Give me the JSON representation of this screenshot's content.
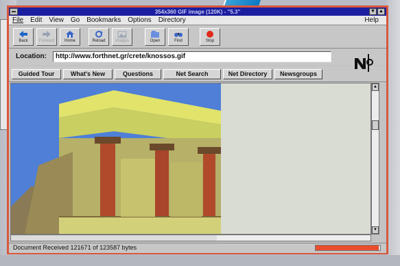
{
  "window": {
    "title": "354x360 GIF image (120K) - \"5.3\""
  },
  "menu": {
    "items": [
      "File",
      "Edit",
      "View",
      "Go",
      "Bookmarks",
      "Options",
      "Directory"
    ],
    "help": "Help"
  },
  "toolbar": {
    "buttons": [
      {
        "label": "Back",
        "icon": "back-arrow-icon",
        "enabled": true
      },
      {
        "label": "Forward",
        "icon": "forward-arrow-icon",
        "enabled": false
      },
      {
        "label": "Home",
        "icon": "home-icon",
        "enabled": true
      },
      {
        "label": "Reload",
        "icon": "reload-icon",
        "enabled": true
      },
      {
        "label": "Images",
        "icon": "images-icon",
        "enabled": false
      },
      {
        "label": "Open",
        "icon": "open-icon",
        "enabled": true
      },
      {
        "label": "Find",
        "icon": "find-icon",
        "enabled": true
      },
      {
        "label": "Stop",
        "icon": "stop-icon",
        "enabled": true
      }
    ]
  },
  "location": {
    "label": "Location:",
    "value": "http://www.forthnet.gr/crete/knossos.gif"
  },
  "directory_buttons": [
    "Guided Tour",
    "What's New",
    "Questions",
    "Net Search",
    "Net Directory",
    "Newsgroups"
  ],
  "content": {
    "image": "palace-of-knossos-photo"
  },
  "status": {
    "text": "Document Received 121671 of 123587 bytes",
    "progress": 0.98
  },
  "colors": {
    "title_bar": "#1b1ea0",
    "window_frame": "#d8573d",
    "progress": "#ea4c2d",
    "sky": "#4f7fd6"
  }
}
